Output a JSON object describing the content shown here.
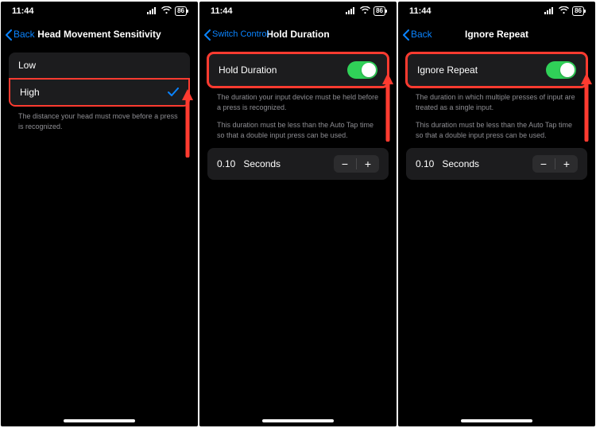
{
  "status": {
    "time": "11:44",
    "battery": "86"
  },
  "screens": {
    "sensitivity": {
      "back_label": "Back",
      "title": "Head Movement Sensitivity",
      "option_low": "Low",
      "option_high": "High",
      "footer": "The distance your head must move before a press is recognized."
    },
    "hold": {
      "back_label": "Switch Control",
      "title": "Hold Duration",
      "toggle_label": "Hold Duration",
      "toggle_on": true,
      "footer1": "The duration your input device must be held before a press is recognized.",
      "footer2": "This duration must be less than the Auto Tap time so that a double input press can be used.",
      "value": "0.10",
      "unit": "Seconds"
    },
    "ignore": {
      "back_label": "Back",
      "title": "Ignore Repeat",
      "toggle_label": "Ignore Repeat",
      "toggle_on": true,
      "footer1": "The duration in which multiple presses of input are treated as a single input.",
      "footer2": "This duration must be less than the Auto Tap time so that a double input press can be used.",
      "value": "0.10",
      "unit": "Seconds"
    }
  }
}
